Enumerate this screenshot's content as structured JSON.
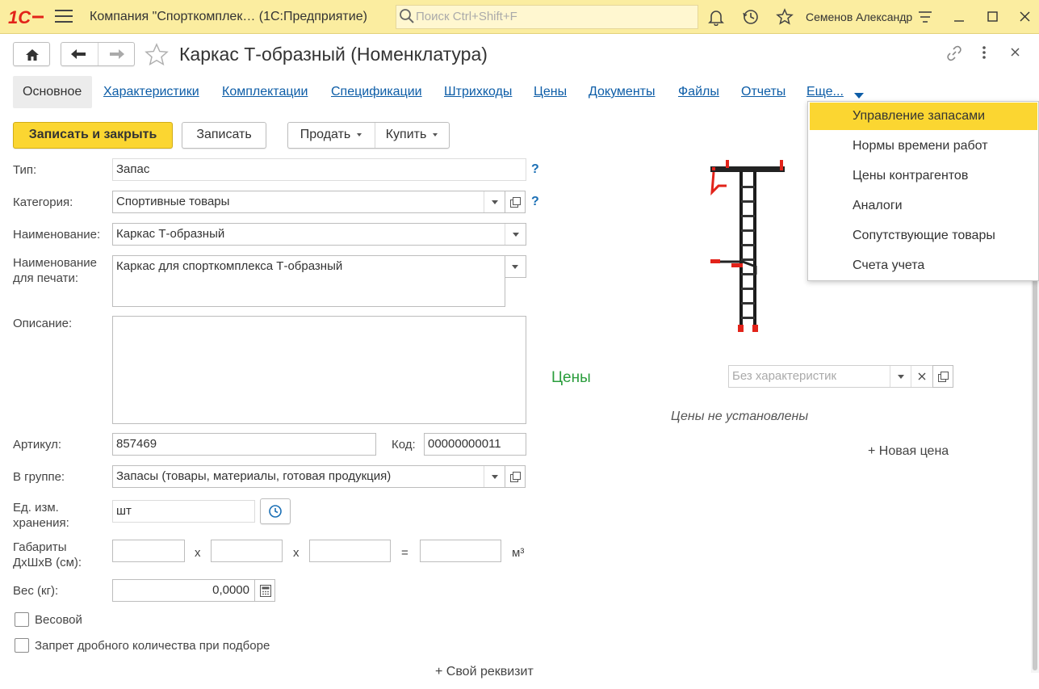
{
  "titlebar": {
    "logo_text": "1С",
    "app_title": "Компания \"Спорткомплек…  (1С:Предприятие)",
    "search_placeholder": "Поиск Ctrl+Shift+F",
    "user": "Семенов Александр"
  },
  "form": {
    "title": "Каркас Т-образный (Номенклатура)"
  },
  "tabs": [
    {
      "label": "Основное",
      "active": true
    },
    {
      "label": "Характеристики"
    },
    {
      "label": "Комплектации"
    },
    {
      "label": "Спецификации"
    },
    {
      "label": "Штрихкоды"
    },
    {
      "label": "Цены"
    },
    {
      "label": "Документы"
    },
    {
      "label": "Файлы"
    },
    {
      "label": "Отчеты"
    },
    {
      "label": "Еще..."
    }
  ],
  "more_menu": {
    "items": [
      "Управление запасами",
      "Нормы времени работ",
      "Цены контрагентов",
      "Аналоги",
      "Сопутствующие товары",
      "Счета учета"
    ],
    "highlighted_index": 0
  },
  "toolbar": {
    "save_close": "Записать и закрыть",
    "save": "Записать",
    "sell": "Продать",
    "buy": "Купить"
  },
  "fields": {
    "type_label": "Тип:",
    "type_value": "Запас",
    "category_label": "Категория:",
    "category_value": "Спортивные товары",
    "name_label": "Наименование:",
    "name_value": "Каркас Т-образный",
    "print_name_label": "Наименование для печати:",
    "print_name_value": "Каркас для спорткомплекса Т-образный",
    "description_label": "Описание:",
    "description_value": "",
    "article_label": "Артикул:",
    "article_value": "857469",
    "code_label": "Код:",
    "code_value": "00000000011",
    "group_label": "В группе:",
    "group_value": "Запасы (товары, материалы, готовая продукция)",
    "unit_label": "Ед. изм. хранения:",
    "unit_value": "шт",
    "dims_label": "Габариты ДхШхВ (см):",
    "dims_x": "x",
    "dims_eq": "=",
    "dims_unit": "м³",
    "weight_label": "Вес (кг):",
    "weight_value": "0,0000",
    "weighed_label": "Весовой",
    "no_fraction_label": "Запрет дробного количества при подборе",
    "custom_attr": "+ Свой реквизит",
    "help": "?"
  },
  "prices": {
    "title": "Цены",
    "char_placeholder": "Без характеристик",
    "empty_text": "Цены не установлены",
    "new_price": "+ Новая цена"
  },
  "colors": {
    "accent_yellow": "#fbd631",
    "titlebar": "#fbeda0",
    "link": "#0d5da7",
    "prices_title": "#2a9d3c",
    "logo_red": "#e2231a"
  }
}
